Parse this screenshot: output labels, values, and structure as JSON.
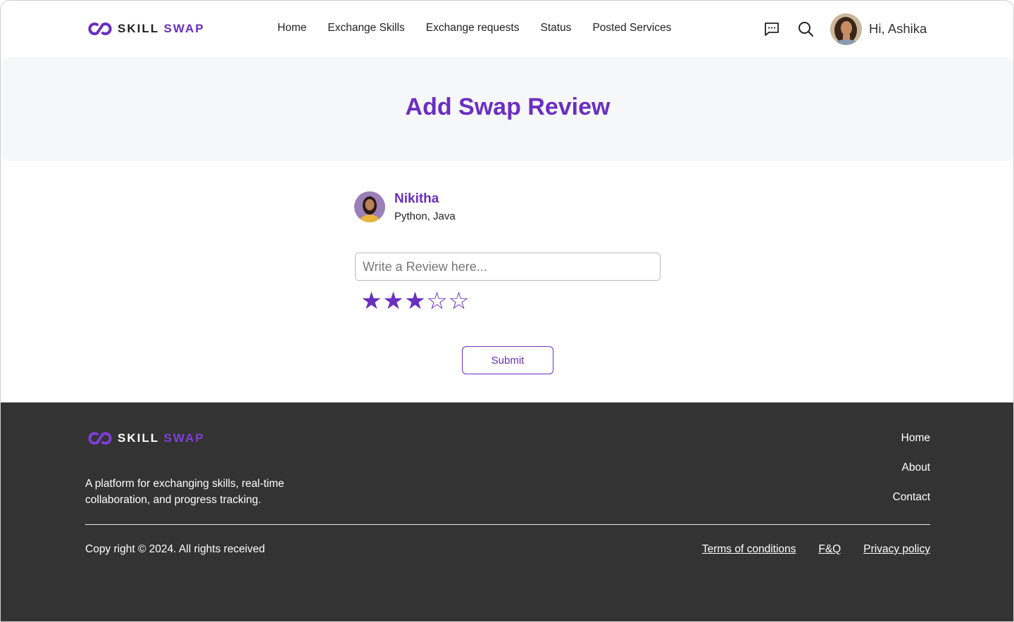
{
  "brand": {
    "word1": "SKILL",
    "word2": "SWAP"
  },
  "nav": {
    "items": [
      {
        "label": "Home"
      },
      {
        "label": "Exchange Skills"
      },
      {
        "label": "Exchange requests"
      },
      {
        "label": "Status"
      },
      {
        "label": "Posted Services"
      }
    ]
  },
  "header": {
    "icons": [
      "message-icon",
      "search-icon"
    ],
    "greeting": "Hi, Ashika"
  },
  "hero": {
    "title": "Add Swap Review"
  },
  "review": {
    "user_name": "Nikitha",
    "user_skills": "Python, Java",
    "input_placeholder": "Write a Review here...",
    "input_value": "",
    "rating": 3,
    "rating_max": 5,
    "submit_label": "Submit"
  },
  "footer": {
    "description": "A platform for exchanging skills, real-time collaboration, and progress tracking.",
    "links": [
      "Home",
      "About",
      "Contact"
    ],
    "copyright": "Copy right © 2024. All rights received",
    "legal_links": [
      "Terms of conditions",
      "F&Q",
      "Privacy policy"
    ]
  },
  "colors": {
    "accent": "#6a2fc0",
    "hero_bg": "#f6f7f9",
    "footer_bg": "#333333"
  }
}
